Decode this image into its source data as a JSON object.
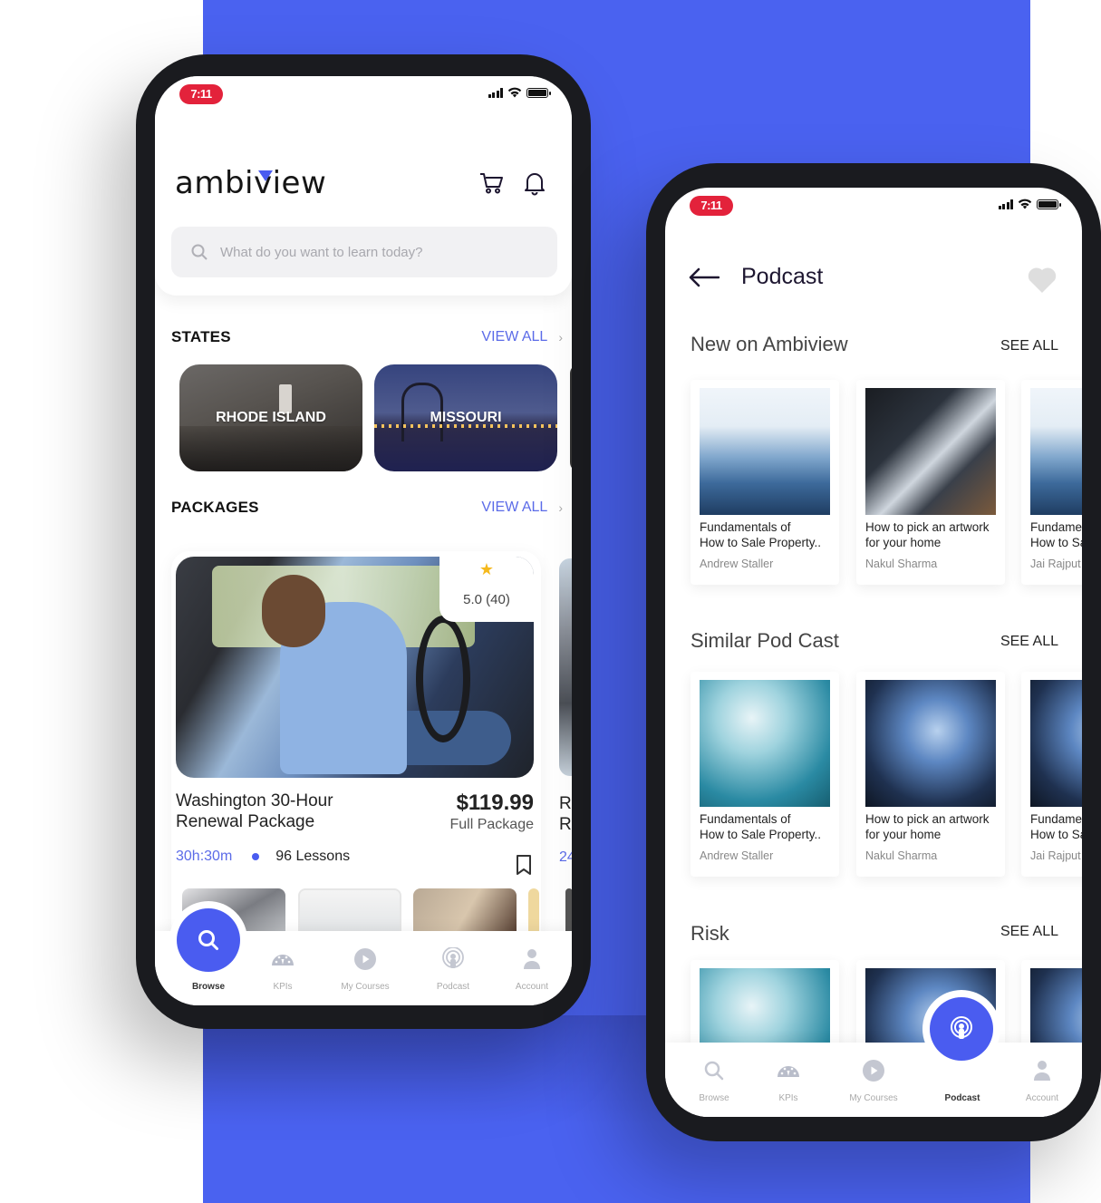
{
  "left_phone": {
    "status": {
      "time": "7:11"
    },
    "brand": {
      "logo_text": "ambiview",
      "accent": "#4a5cf0"
    },
    "header_icons": [
      "cart-icon",
      "bell-icon"
    ],
    "search": {
      "placeholder": "What do you want to learn today?"
    },
    "states_section": {
      "title": "STATES",
      "view_all": "VIEW ALL",
      "cards": [
        {
          "label": "RHODE ISLAND"
        },
        {
          "label": "MISSOURI"
        }
      ]
    },
    "packages_section": {
      "title": "PACKAGES",
      "view_all": "VIEW ALL",
      "cards": [
        {
          "rating": "5.0 (40)",
          "title_line1": "Washington 30-Hour",
          "title_line2": "Renewal Package",
          "price": "$119.99",
          "price_sub": "Full Package",
          "duration": "30h:30m",
          "lessons": "96 Lessons"
        }
      ],
      "peek_card": {
        "line1": "R",
        "line2": "R",
        "meta": "24"
      }
    },
    "bottom_nav": [
      {
        "label": "Browse",
        "icon": "search-icon",
        "active": true
      },
      {
        "label": "KPIs",
        "icon": "gauge-icon",
        "active": false
      },
      {
        "label": "My Courses",
        "icon": "play-icon",
        "active": false
      },
      {
        "label": "Podcast",
        "icon": "podcast-icon",
        "active": false
      },
      {
        "label": "Account",
        "icon": "user-icon",
        "active": false
      }
    ]
  },
  "right_phone": {
    "status": {
      "time": "7:11"
    },
    "header": {
      "title": "Podcast"
    },
    "sections": [
      {
        "title": "New on Ambiview",
        "see_all": "SEE ALL",
        "cards": [
          {
            "title_line1": "Fundamentals of",
            "title_line2": "How to Sale Property..",
            "author": "Andrew Staller"
          },
          {
            "title_line1": "How to pick an artwork",
            "title_line2": "for your home",
            "author": "Nakul Sharma"
          },
          {
            "title_line1": "Fundamentals of",
            "title_line2": "How to Sale Property..",
            "author": "Jai Rajput"
          }
        ]
      },
      {
        "title": "Similar Pod Cast",
        "see_all": "SEE ALL",
        "cards": [
          {
            "title_line1": "Fundamentals of",
            "title_line2": "How to Sale Property..",
            "author": "Andrew Staller"
          },
          {
            "title_line1": "How to pick an artwork",
            "title_line2": "for your home",
            "author": "Nakul Sharma"
          },
          {
            "title_line1": "Fundamentals of",
            "title_line2": "How to Sale Property..",
            "author": "Jai Rajput"
          }
        ]
      },
      {
        "title": "Risk",
        "see_all": "SEE ALL",
        "cards": [
          {},
          {},
          {}
        ]
      }
    ],
    "bottom_nav": [
      {
        "label": "Browse",
        "icon": "search-icon",
        "active": false
      },
      {
        "label": "KPIs",
        "icon": "gauge-icon",
        "active": false
      },
      {
        "label": "My Courses",
        "icon": "play-icon",
        "active": false
      },
      {
        "label": "Podcast",
        "icon": "podcast-icon",
        "active": true
      },
      {
        "label": "Account",
        "icon": "user-icon",
        "active": false
      }
    ]
  },
  "colors": {
    "background_block": "#4a62f0",
    "accent": "#4a5cf0",
    "time_pill": "#e3223b",
    "link": "#5b6be8"
  }
}
